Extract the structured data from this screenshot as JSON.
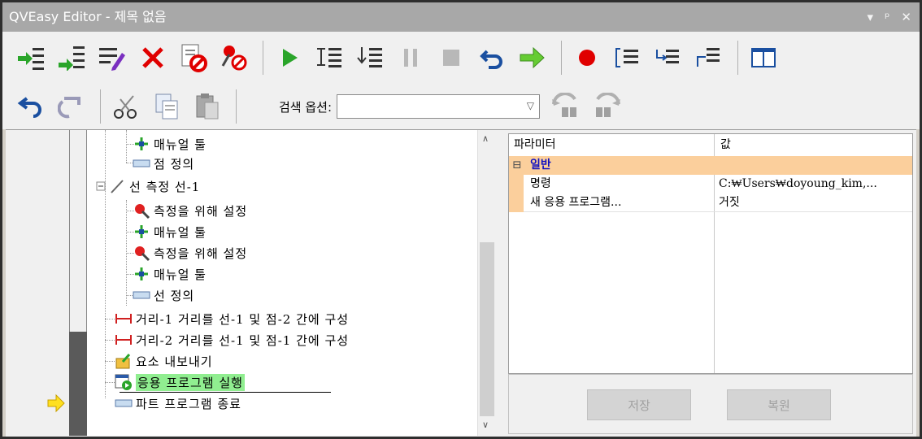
{
  "window": {
    "title": "QVEasy Editor - 제목 없음",
    "controls": [
      "▾",
      "ᵖ",
      "✕"
    ]
  },
  "toolbar2": {
    "search_label": "검색 옵션:",
    "search_value": ""
  },
  "tree": {
    "rows": [
      {
        "label": "매뉴얼 툴",
        "icon": "manual-tool-icon"
      },
      {
        "label": "점 정의",
        "icon": "point-define-icon"
      },
      {
        "label": "선 측정 선-1",
        "icon": "line-measure-icon"
      },
      {
        "label": "측정을 위해 설정",
        "icon": "pin-icon"
      },
      {
        "label": "매뉴얼 툴",
        "icon": "manual-tool-icon"
      },
      {
        "label": "측정을 위해 설정",
        "icon": "pin-icon"
      },
      {
        "label": "매뉴얼 툴",
        "icon": "manual-tool-icon"
      },
      {
        "label": "선 정의",
        "icon": "line-define-icon"
      },
      {
        "label": "거리-1 거리를 선-1 및 점-2 간에 구성",
        "icon": "distance-icon"
      },
      {
        "label": "거리-2 거리를 선-1 및 점-1 간에 구성",
        "icon": "distance-icon"
      },
      {
        "label": "요소 내보내기",
        "icon": "export-icon"
      },
      {
        "label": "응용 프로그램 실행",
        "icon": "run-app-icon"
      },
      {
        "label": "파트 프로그램 종료",
        "icon": "end-program-icon"
      }
    ]
  },
  "props": {
    "header_param": "파라미터",
    "header_value": "값",
    "group_label": "일반",
    "group_toggle": "⊟",
    "rows": [
      {
        "param": "명령",
        "value": "C:₩Users₩doyoung_kim,..."
      },
      {
        "param": "새 응용 프로그램...",
        "value": "거짓"
      }
    ],
    "save_label": "저장",
    "restore_label": "복원"
  },
  "colors": {
    "highlight": "#90ee90",
    "group_bg": "#fbcf9c",
    "group_text": "#1010c0",
    "run_green": "#2aa52a",
    "stop_red": "#e00000"
  }
}
